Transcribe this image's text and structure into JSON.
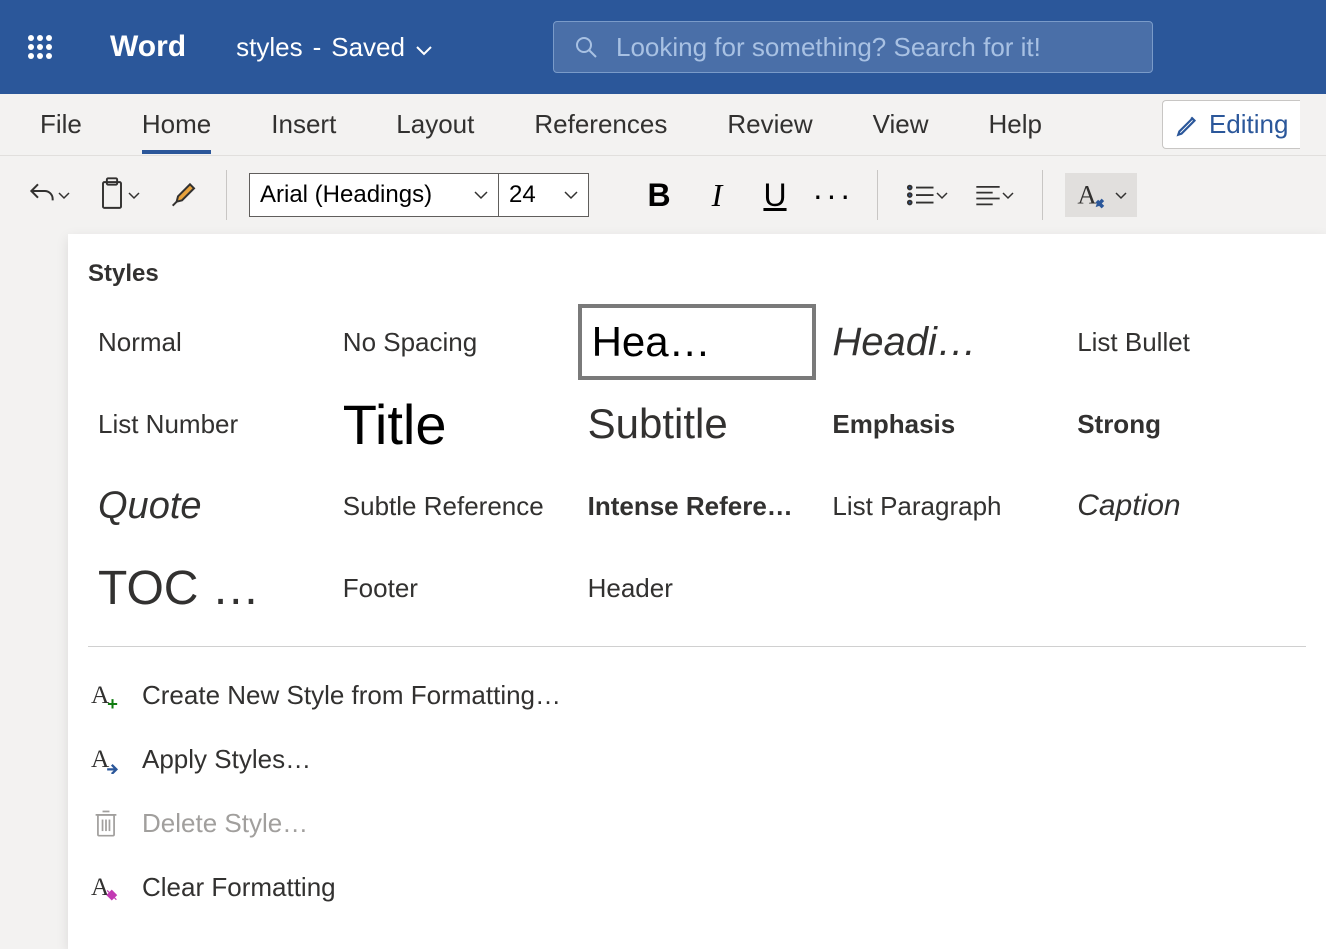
{
  "titlebar": {
    "app_name": "Word",
    "doc_name": "styles",
    "save_status": "Saved"
  },
  "search": {
    "placeholder": "Looking for something? Search for it!"
  },
  "tabs": {
    "items": [
      "File",
      "Home",
      "Insert",
      "Layout",
      "References",
      "Review",
      "View",
      "Help"
    ],
    "active_index": 1,
    "editing_label": "Editing"
  },
  "toolbar": {
    "font_name": "Arial (Headings)",
    "font_size": "24"
  },
  "styles_panel": {
    "header": "Styles",
    "styles": [
      {
        "label": "Normal",
        "variant": "normal"
      },
      {
        "label": "No Spacing",
        "variant": "normal"
      },
      {
        "label": "Hea…",
        "variant": "heading1",
        "selected": true
      },
      {
        "label": "Headi…",
        "variant": "heading2"
      },
      {
        "label": "List Bullet",
        "variant": "normal"
      },
      {
        "label": "List Number",
        "variant": "normal"
      },
      {
        "label": "Title",
        "variant": "title"
      },
      {
        "label": "Subtitle",
        "variant": "subtitle"
      },
      {
        "label": "Emphasis",
        "variant": "emphasis"
      },
      {
        "label": "Strong",
        "variant": "strong"
      },
      {
        "label": "Quote",
        "variant": "quote"
      },
      {
        "label": "Subtle Reference",
        "variant": "normal"
      },
      {
        "label": "Intense Refere…",
        "variant": "intense"
      },
      {
        "label": "List Paragraph",
        "variant": "normal"
      },
      {
        "label": "Caption",
        "variant": "caption"
      },
      {
        "label": "TOC …",
        "variant": "toc"
      },
      {
        "label": "Footer",
        "variant": "normal"
      },
      {
        "label": "Header",
        "variant": "normal"
      }
    ],
    "actions": [
      {
        "label": "Create New Style from Formatting…",
        "icon": "new",
        "disabled": false
      },
      {
        "label": "Apply Styles…",
        "icon": "apply",
        "disabled": false
      },
      {
        "label": "Delete Style…",
        "icon": "delete",
        "disabled": true
      },
      {
        "label": "Clear Formatting",
        "icon": "clear",
        "disabled": false
      }
    ]
  }
}
